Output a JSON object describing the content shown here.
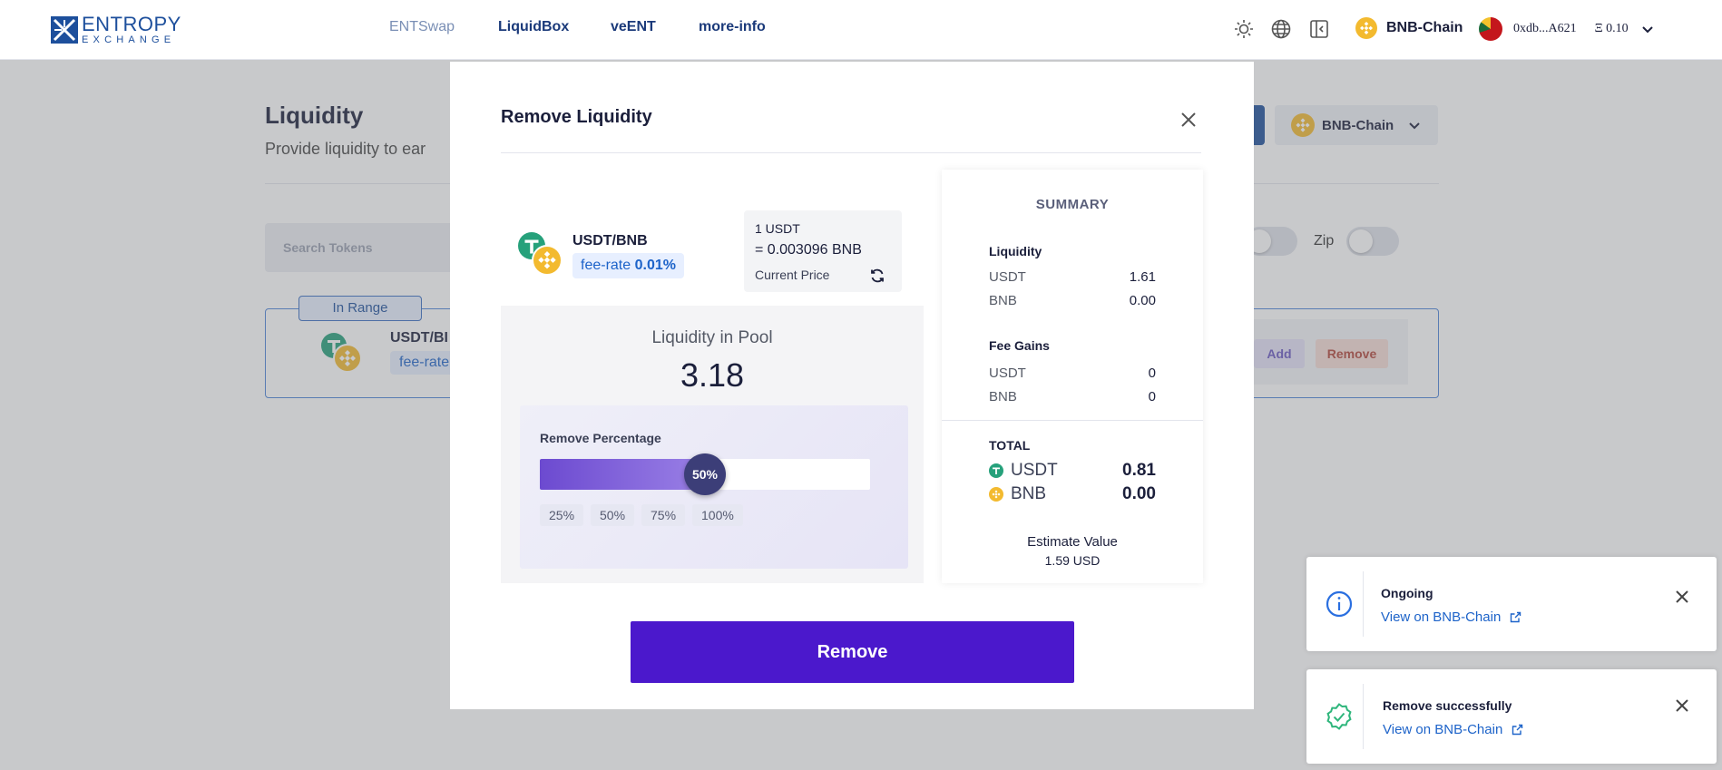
{
  "brand": {
    "name_line1": "ENTROPY",
    "name_line2": "EXCHANGE"
  },
  "nav": [
    {
      "label": "ENTSwap"
    },
    {
      "label": "LiquidBox"
    },
    {
      "label": "veENT"
    },
    {
      "label": "more-info"
    }
  ],
  "topbar": {
    "chain": "BNB-Chain",
    "wallet_address": "0xdb...A621",
    "wallet_balance": "Ξ 0.10"
  },
  "background_page": {
    "title": "Liquidity",
    "subtitle": "Provide liquidity to ear",
    "chain_selector": "BNB-Chain",
    "search_placeholder": "Search Tokens",
    "zip_label": "Zip",
    "position": {
      "badge": "In Range",
      "pair": "USDT/BI",
      "fee_label": "fee-rate",
      "add_label": "Add",
      "remove_label": "Remove"
    }
  },
  "modal": {
    "title": "Remove Liquidity",
    "pair": "USDT/BNB",
    "fee_label": "fee-rate",
    "fee_value": "0.01%",
    "price": {
      "line1": "1 USDT",
      "line2": "= 0.003096 BNB",
      "label": "Current Price"
    },
    "pool_label": "Liquidity in Pool",
    "pool_value": "3.18",
    "percentage": {
      "label": "Remove Percentage",
      "value": 50,
      "value_label": "50%",
      "quick_options": [
        "25%",
        "50%",
        "75%",
        "100%"
      ]
    },
    "summary": {
      "title": "SUMMARY",
      "liquidity_heading": "Liquidity",
      "liquidity": [
        {
          "token": "USDT",
          "amount": "1.61"
        },
        {
          "token": "BNB",
          "amount": "0.00"
        }
      ],
      "fee_heading": "Fee Gains",
      "fees": [
        {
          "token": "USDT",
          "amount": "0"
        },
        {
          "token": "BNB",
          "amount": "0"
        }
      ],
      "total_heading": "TOTAL",
      "total": [
        {
          "token": "USDT",
          "amount": "0.81"
        },
        {
          "token": "BNB",
          "amount": "0.00"
        }
      ],
      "estimate_label": "Estimate Value",
      "estimate_value": "1.59 USD"
    },
    "remove_button": "Remove"
  },
  "toasts": [
    {
      "title": "Ongoing",
      "link": "View on BNB-Chain",
      "status": "info"
    },
    {
      "title": "Remove successfully",
      "link": "View on BNB-Chain",
      "status": "success"
    }
  ],
  "colors": {
    "brand_blue": "#1d4f9c",
    "primary_purple": "#4b18cc",
    "usdt_green": "#26a17b",
    "bnb_yellow": "#f3ba2f",
    "success_green": "#2fb67c",
    "info_blue": "#2a6fe0"
  }
}
